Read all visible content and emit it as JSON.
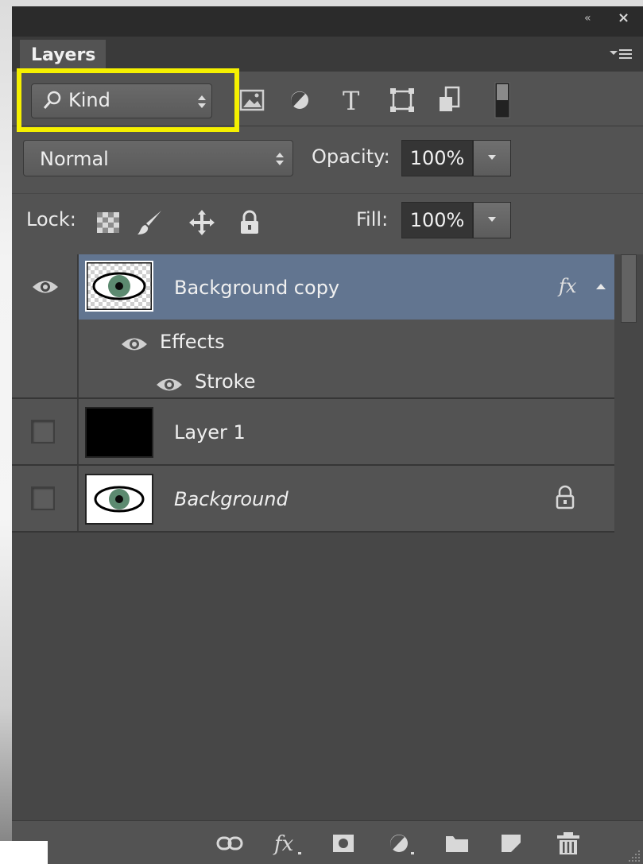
{
  "panel": {
    "title": "Layers",
    "collapse_glyph": "«",
    "close_glyph": "×"
  },
  "filter": {
    "kind_label": "Kind",
    "icons": [
      "pixel-layer-filter-icon",
      "adjustment-layer-filter-icon",
      "type-layer-filter-icon",
      "shape-layer-filter-icon",
      "smart-object-filter-icon",
      "filter-toggle-icon"
    ]
  },
  "blend": {
    "mode": "Normal",
    "opacity_label": "Opacity:",
    "opacity_value": "100%",
    "fill_label": "Fill:",
    "fill_value": "100%"
  },
  "lock": {
    "label": "Lock:",
    "icons": [
      "lock-transparent-pixels-icon",
      "lock-image-pixels-icon",
      "lock-position-icon",
      "lock-all-icon"
    ]
  },
  "layers": [
    {
      "name": "Background copy",
      "selected": true,
      "visible": true,
      "has_fx": true,
      "fx_label": "fx",
      "effects_label": "Effects",
      "effects": [
        {
          "name": "Stroke"
        }
      ]
    },
    {
      "name": "Layer 1",
      "selected": false,
      "visible": false
    },
    {
      "name": "Background",
      "selected": false,
      "visible": false,
      "locked": true,
      "italic": true
    }
  ],
  "bottom_icons": [
    "link-layers-icon",
    "add-layer-style-icon",
    "add-layer-mask-icon",
    "new-adjustment-layer-icon",
    "new-group-icon",
    "new-layer-icon",
    "delete-layer-icon"
  ],
  "colors": {
    "highlight": "#f5f000",
    "selected_row": "#627590",
    "panel_bg": "#474747"
  }
}
